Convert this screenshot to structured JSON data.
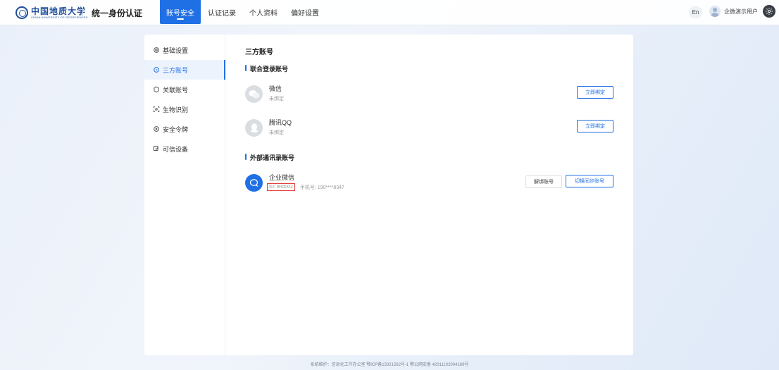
{
  "header": {
    "logo_cn": "中国地质大学",
    "logo_en": "CHINA UNIVERSITY OF GEOSCIENCES",
    "app_title": "统一身份认证",
    "nav": [
      {
        "label": "账号安全",
        "active": true
      },
      {
        "label": "认证记录",
        "active": false
      },
      {
        "label": "个人资料",
        "active": false
      },
      {
        "label": "偏好设置",
        "active": false
      }
    ],
    "lang_label": "En",
    "user_name": "企微演示用户"
  },
  "sidebar": {
    "items": [
      {
        "label": "基础设置",
        "icon": "gear-icon",
        "active": false
      },
      {
        "label": "三方账号",
        "icon": "link-icon",
        "active": true
      },
      {
        "label": "关联账号",
        "icon": "chain-icon",
        "active": false
      },
      {
        "label": "生物识别",
        "icon": "face-scan-icon",
        "active": false
      },
      {
        "label": "安全令牌",
        "icon": "shield-icon",
        "active": false
      },
      {
        "label": "可信设备",
        "icon": "device-icon",
        "active": false
      }
    ]
  },
  "main": {
    "page_title": "三方账号",
    "section_joint": "联合登录账号",
    "accounts": [
      {
        "name": "微信",
        "status": "未绑定",
        "button": "立即绑定",
        "icon": "wechat-icon"
      },
      {
        "name": "腾讯QQ",
        "status": "未绑定",
        "button": "立即绑定",
        "icon": "qq-icon"
      }
    ],
    "section_external": "外部通讯录账号",
    "external": {
      "name": "企业微信",
      "id_text": "ID: test002",
      "phone_text": "手机号: 190****8347",
      "unbind_button": "解绑账号",
      "switch_button": "切换同步账号",
      "icon": "wework-icon"
    }
  },
  "footer": {
    "text": "系统维护：信息化工作办公室 鄂ICP备15021562号-1 鄂公网安备 42011102004169号"
  },
  "colors": {
    "accent": "#1f6fe5",
    "highlight_border": "#e43b3b"
  }
}
